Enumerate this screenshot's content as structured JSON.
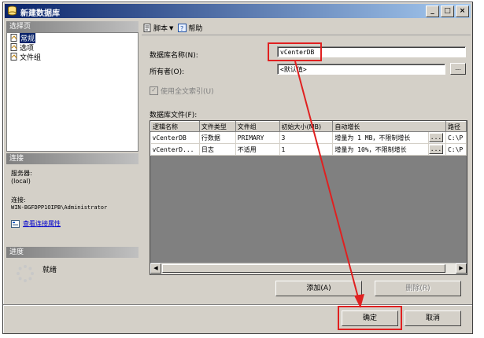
{
  "window": {
    "title": "新建数据库",
    "controls": [
      "_",
      "□",
      "×"
    ]
  },
  "select_page": {
    "header": "选择页",
    "items": [
      {
        "label": "常规",
        "icon": "page-icon",
        "selected": true
      },
      {
        "label": "选项",
        "icon": "page-icon",
        "selected": false
      },
      {
        "label": "文件组",
        "icon": "page-icon",
        "selected": false
      }
    ]
  },
  "connection": {
    "header": "连接",
    "server_label": "服务器:",
    "server_value": "(local)",
    "conn_label": "连接:",
    "conn_value": "WIN-BGFDPP1OIPB\\Administrator",
    "view_props_link": "查看连接属性"
  },
  "progress": {
    "header": "进度",
    "status": "就绪"
  },
  "toolbar": {
    "script_label": "脚本",
    "help_label": "帮助"
  },
  "form": {
    "db_name_label": "数据库名称(N):",
    "db_name_value": "vCenterDB",
    "owner_label": "所有者(O):",
    "owner_value": "<默认值>",
    "fulltext_label": "使用全文索引(U)",
    "files_label": "数据库文件(F):"
  },
  "files_table": {
    "columns": [
      "逻辑名称",
      "文件类型",
      "文件组",
      "初始大小(MB)",
      "自动增长",
      "路径"
    ],
    "rows": [
      {
        "logical": "vCenterDB",
        "type": "行数据",
        "group": "PRIMARY",
        "size": "3",
        "growth": "增量为 1 MB，不限制增长",
        "path": "C:\\P"
      },
      {
        "logical": "vCenterD...",
        "type": "日志",
        "group": "不适用",
        "size": "1",
        "growth": "增量为 10%，不限制增长",
        "path": "C:\\P"
      }
    ]
  },
  "buttons": {
    "add": "添加(A)",
    "remove": "删除(R)",
    "ok": "确定",
    "cancel": "取消",
    "ellipsis": "..."
  },
  "colors": {
    "highlight": "#e02020",
    "title_start": "#0a246a",
    "title_end": "#a6caf0"
  }
}
